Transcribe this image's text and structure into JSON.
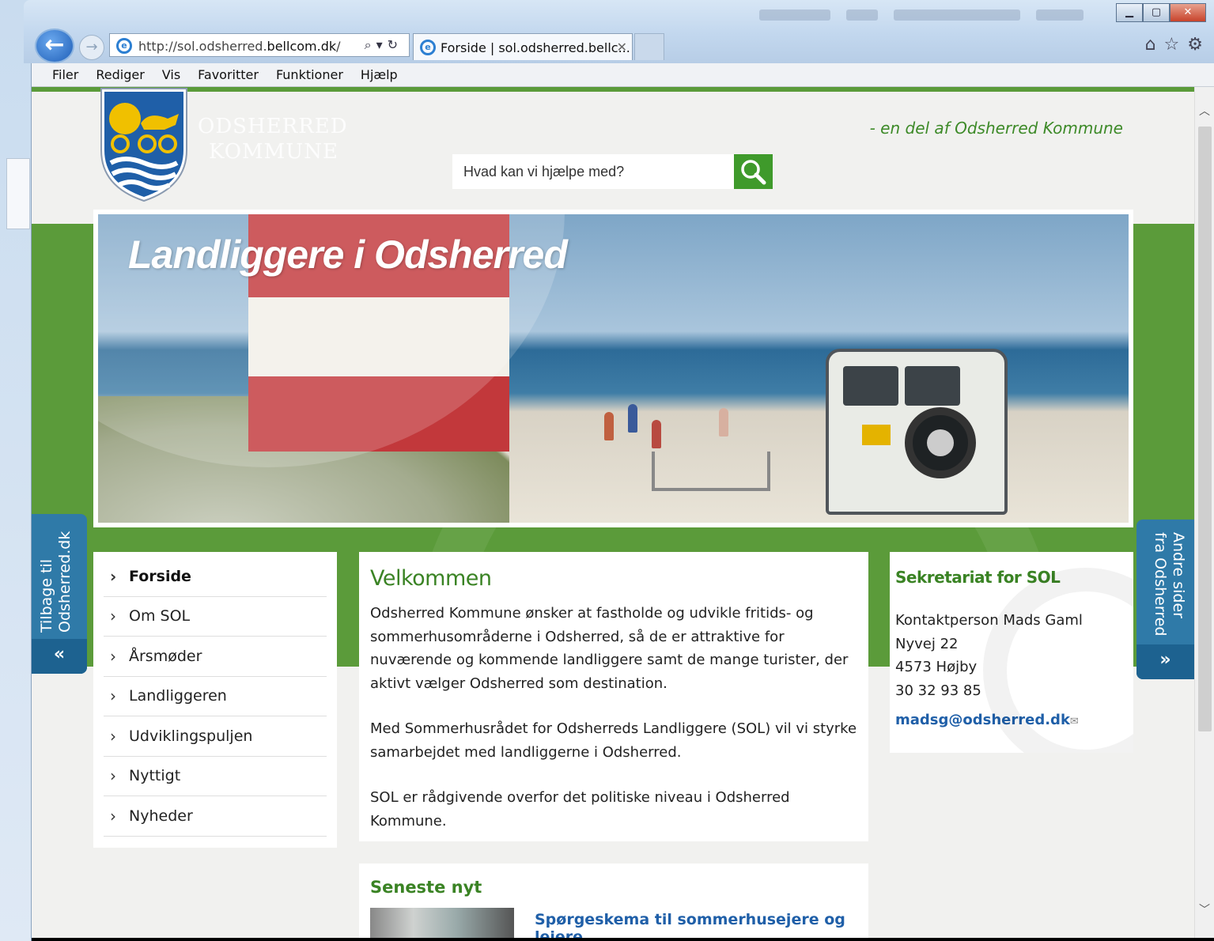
{
  "browser": {
    "url_prefix": "http://sol.odsherred.",
    "url_domain": "bellcom.dk",
    "url_suffix": "/",
    "tab_title": "Forside | sol.odsherred.bellc...",
    "menu": [
      "Filer",
      "Rediger",
      "Vis",
      "Favoritter",
      "Funktioner",
      "Hjælp"
    ]
  },
  "site": {
    "logo_line1": "ODSHERRED",
    "logo_line2": "KOMMUNE",
    "tagline": "- en del af Odsherred Kommune",
    "search_placeholder": "Hvad kan vi hjælpe med?",
    "hero_title": "Landliggere i Odsherred",
    "side_left": "Tilbage til Odsherred.dk",
    "side_right": "Andre sider fra Odsherred",
    "side_left_chev": "«",
    "side_right_chev": "»"
  },
  "nav": {
    "items": [
      {
        "label": "Forside",
        "active": true
      },
      {
        "label": "Om SOL"
      },
      {
        "label": "Årsmøder"
      },
      {
        "label": "Landliggeren"
      },
      {
        "label": "Udviklingspuljen"
      },
      {
        "label": "Nyttigt"
      },
      {
        "label": "Nyheder"
      }
    ]
  },
  "main": {
    "title": "Velkommen",
    "p1": "Odsherred Kommune ønsker at fastholde og udvikle fritids- og sommerhusområderne i Odsherred, så de er attraktive for nuværende og kommende landliggere samt de mange turister, der aktivt vælger Odsherred som destination.",
    "p2": "Med Sommerhusrådet for Odsherreds Landliggere (SOL) vil vi styrke samarbejdet med landliggerne i Odsherred.",
    "p3": "SOL er rådgivende overfor det politiske niveau i Odsherred Kommune."
  },
  "news": {
    "title": "Seneste nyt",
    "item": "Spørgeskema til sommerhusejere og lejere"
  },
  "contact": {
    "title": "Sekretariat for SOL",
    "person": "Kontaktperson Mads Gaml",
    "street": "Nyvej 22",
    "city": "4573 Højby",
    "phone": "30 32 93 85",
    "email": "madsg@odsherred.dk"
  },
  "colors": {
    "green": "#5b9b3a",
    "heading_green": "#3a8324",
    "side_blue": "#2f7aa8",
    "link_blue": "#1f5fa8"
  }
}
